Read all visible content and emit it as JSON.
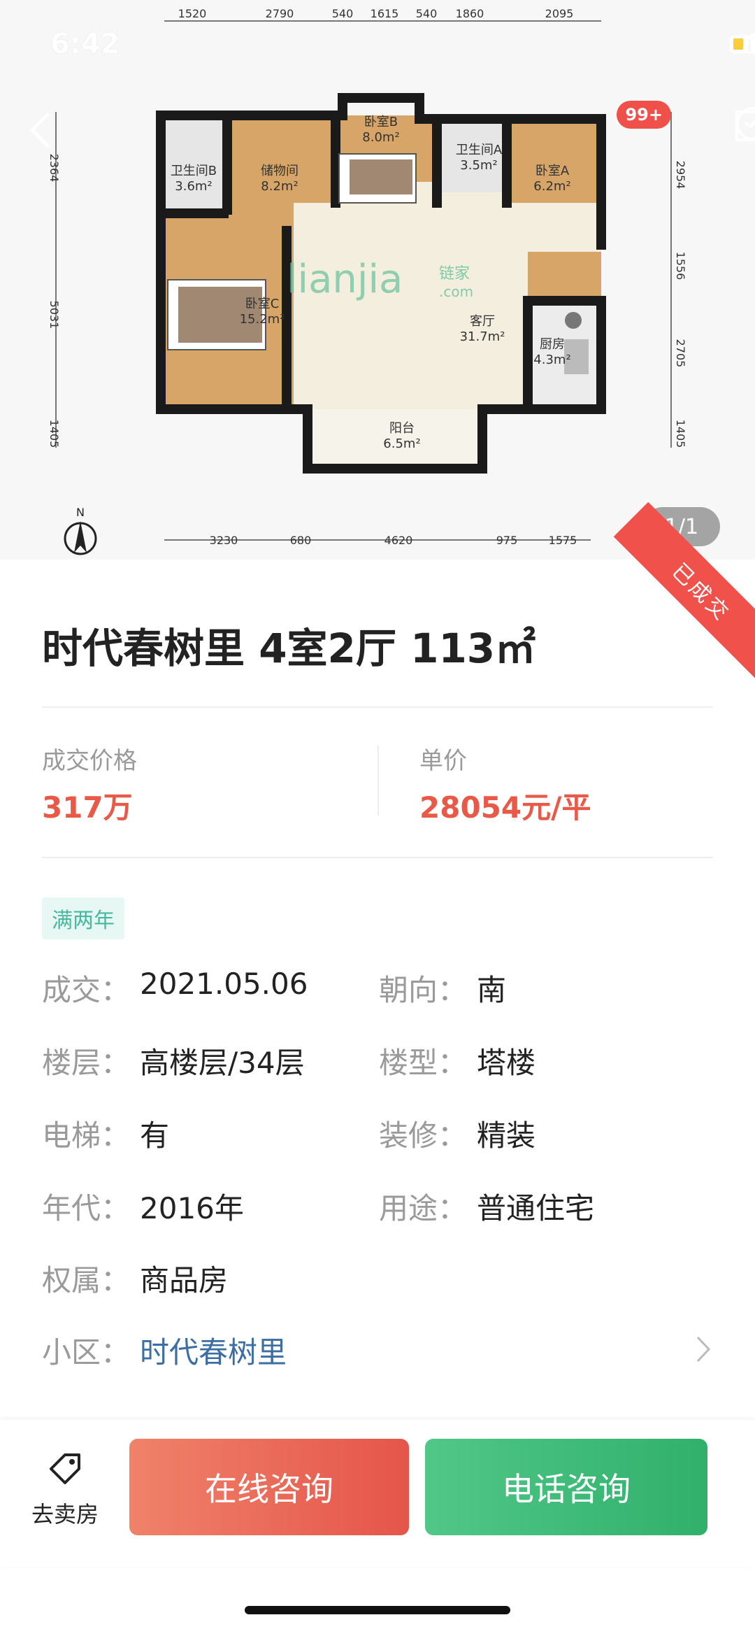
{
  "status": {
    "time": "6:42"
  },
  "badge": "99+",
  "page_indicator": "1/1",
  "sold_ribbon": "已成交",
  "floorplan": {
    "rooms": [
      {
        "name": "卫生间B",
        "area": "3.6m²"
      },
      {
        "name": "储物间",
        "area": "8.2m²"
      },
      {
        "name": "卧室B",
        "area": "8.0m²"
      },
      {
        "name": "卫生间A",
        "area": "3.5m²"
      },
      {
        "name": "卧室A",
        "area": "6.2m²"
      },
      {
        "name": "卧室C",
        "area": "15.2m²"
      },
      {
        "name": "客厅",
        "area": "31.7m²"
      },
      {
        "name": "厨房",
        "area": "4.3m²"
      },
      {
        "name": "阳台",
        "area": "6.5m²"
      }
    ],
    "dims_top": [
      "1520",
      "2790",
      "540",
      "1615",
      "540",
      "1860",
      "2095"
    ],
    "dims_bottom": [
      "3230",
      "680",
      "4620",
      "975",
      "1575"
    ],
    "dims_left": [
      "2364",
      "5031",
      "1405"
    ],
    "dims_right": [
      "2954",
      "1556",
      "2705",
      "1405"
    ],
    "compass": "N",
    "watermark": "lianjia",
    "watermark_cn": "链家",
    "watermark_com": ".com"
  },
  "title": "时代春树里 4室2厅 113㎡",
  "price": {
    "deal_label": "成交价格",
    "deal_value": "317万",
    "unit_label": "单价",
    "unit_value": "28054元/平"
  },
  "tag": "满两年",
  "info": {
    "deal_key": "成交：",
    "deal_val": "2021.05.06",
    "orient_key": "朝向：",
    "orient_val": "南",
    "floor_key": "楼层：",
    "floor_val": "高楼层/34层",
    "type_key": "楼型：",
    "type_val": "塔楼",
    "elevator_key": "电梯：",
    "elevator_val": "有",
    "decor_key": "装修：",
    "decor_val": "精装",
    "year_key": "年代：",
    "year_val": "2016年",
    "use_key": "用途：",
    "use_val": "普通住宅",
    "right_key": "权属：",
    "right_val": "商品房",
    "community_key": "小区：",
    "community_val": "时代春树里"
  },
  "bottom": {
    "sell_label": "去卖房",
    "online_label": "在线咨询",
    "phone_label": "电话咨询"
  },
  "colors": {
    "accent_red": "#e85a47",
    "accent_green": "#30b06b",
    "link_blue": "#3c6ea4",
    "wall": "#1a1a1a",
    "room_wood": "#d7a567"
  }
}
